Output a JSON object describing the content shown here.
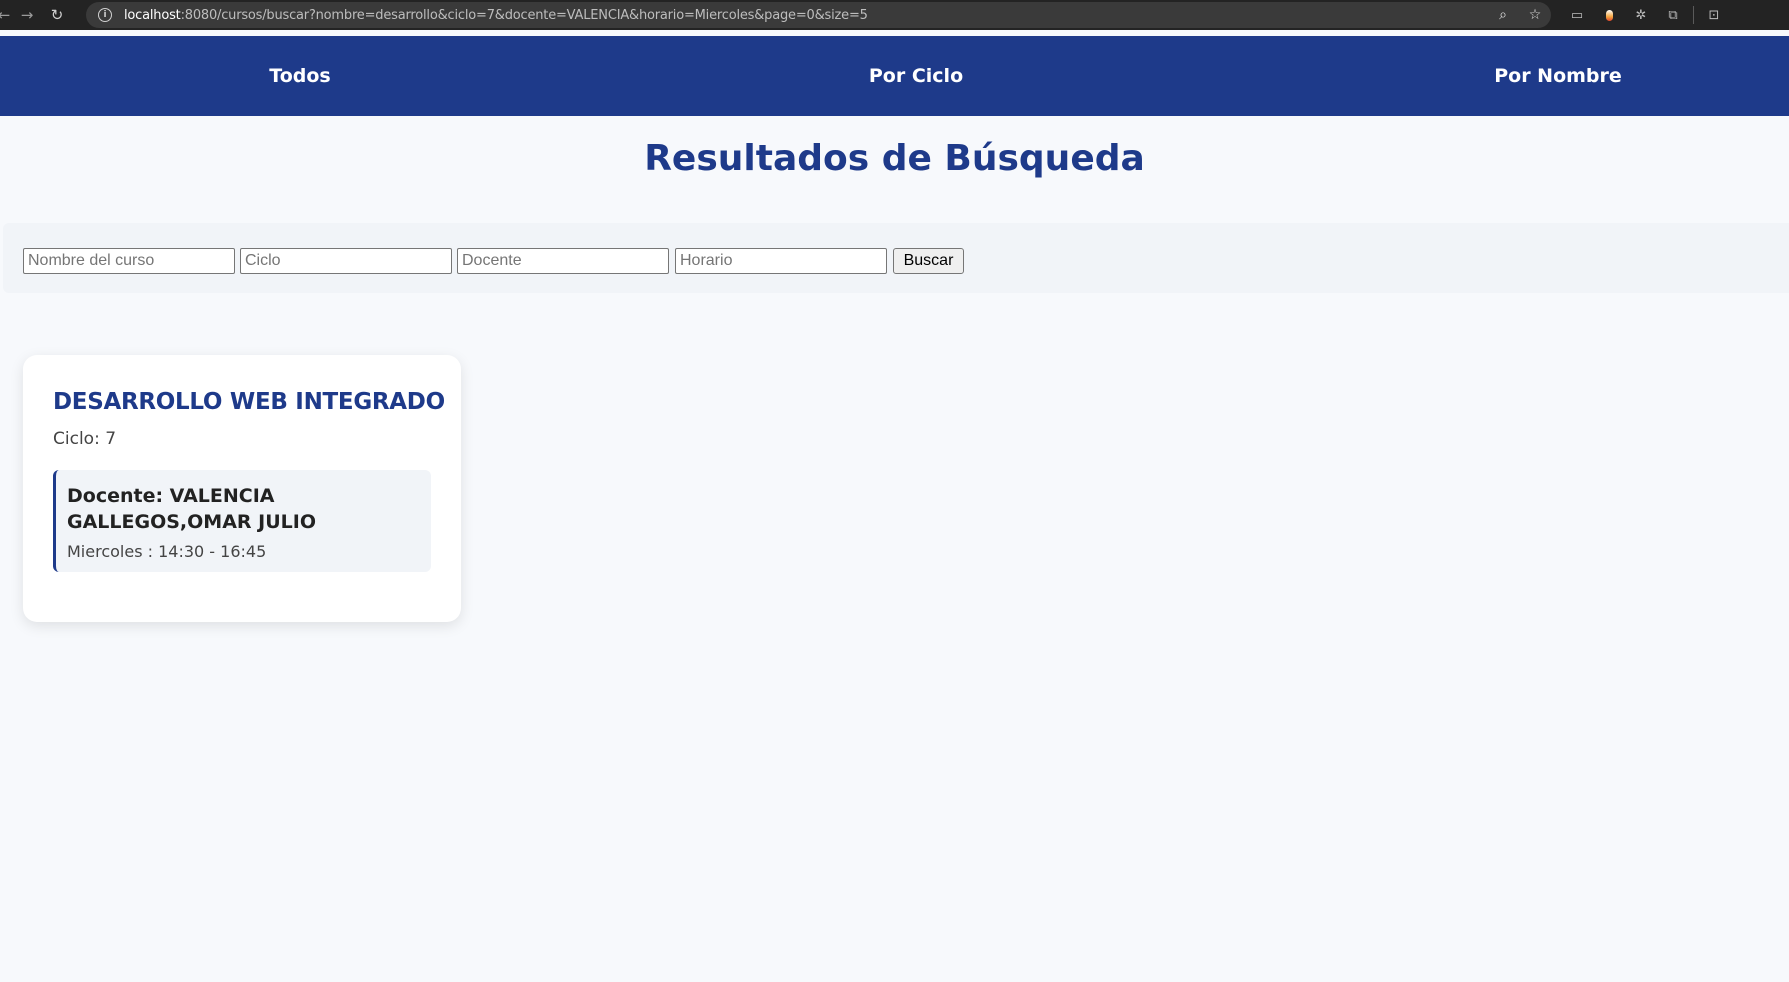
{
  "browser": {
    "url_host": "localhost",
    "url_rest": ":8080/cursos/buscar?nombre=desarrollo&ciclo=7&docente=VALENCIA&horario=Miercoles&page=0&size=5"
  },
  "nav": {
    "todos": "Todos",
    "por_ciclo": "Por Ciclo",
    "por_nombre": "Por Nombre"
  },
  "page": {
    "title": "Resultados de Búsqueda"
  },
  "search": {
    "nombre_placeholder": "Nombre del curso",
    "ciclo_placeholder": "Ciclo",
    "docente_placeholder": "Docente",
    "horario_placeholder": "Horario",
    "button_label": "Buscar"
  },
  "results": [
    {
      "title": "DESARROLLO WEB INTEGRADO",
      "ciclo_label": "Ciclo: ",
      "ciclo_value": "7",
      "docente": "Docente: VALENCIA GALLEGOS,OMAR JULIO",
      "horario": "Miercoles : 14:30 - 16:45"
    }
  ],
  "colors": {
    "primary": "#1e3a8a",
    "page_bg": "#f7f9fc",
    "panel_bg": "#f1f4f8"
  }
}
